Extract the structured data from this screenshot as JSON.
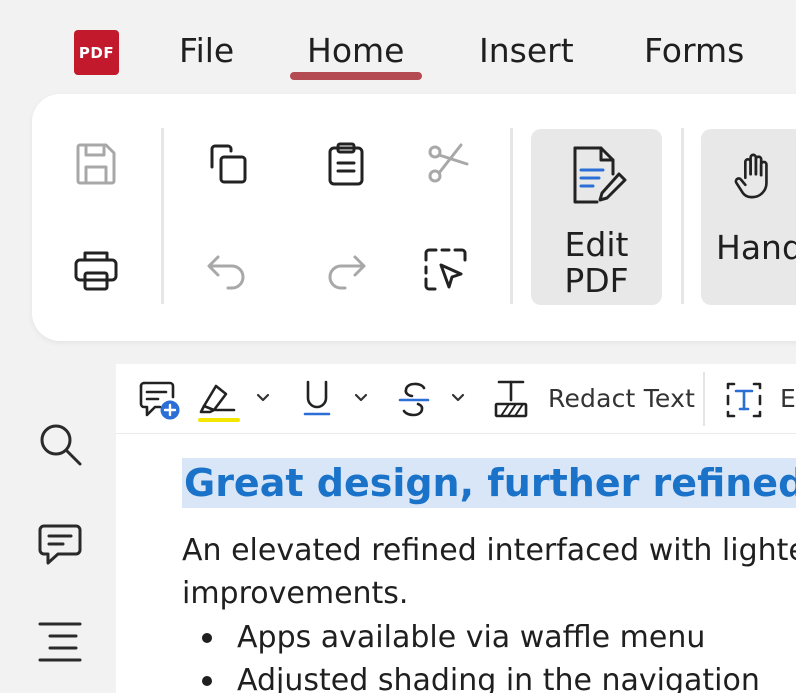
{
  "app": {
    "logo_text": "PDF"
  },
  "menu": {
    "tabs": [
      {
        "label": "File"
      },
      {
        "label": "Home"
      },
      {
        "label": "Insert"
      },
      {
        "label": "Forms"
      }
    ],
    "active": "Home"
  },
  "ribbon": {
    "icons": [
      "save-icon",
      "print-icon",
      "copy-icon",
      "undo-icon",
      "paste-icon",
      "redo-icon",
      "cut-icon",
      "select-icon",
      "edit-pdf-icon",
      "hand-icon"
    ],
    "edit_pdf_line1": "Edit",
    "edit_pdf_line2": "PDF",
    "hand_label": "Hand"
  },
  "annotation_toolbar": {
    "redact_label": "Redact Text",
    "truncated_label": "E",
    "highlight_color": "#f3e600",
    "underline_color": "#2b6fd6",
    "strike_color": "#2b6fd6"
  },
  "sidebar": {
    "icons": [
      "search-icon",
      "comment-icon",
      "outline-icon"
    ]
  },
  "document": {
    "heading": "Great design, further refined",
    "paragraph_line1": "An elevated refined interfaced with lighte",
    "paragraph_line2": "improvements.",
    "bullets": [
      "Apps available via waffle menu",
      "Adjusted shading in the navigation"
    ]
  },
  "colors": {
    "logo_red": "#c21a2c",
    "tab_indicator": "#b44a52",
    "heading_blue": "#1a73c9",
    "heading_highlight": "#d9e6f7"
  }
}
